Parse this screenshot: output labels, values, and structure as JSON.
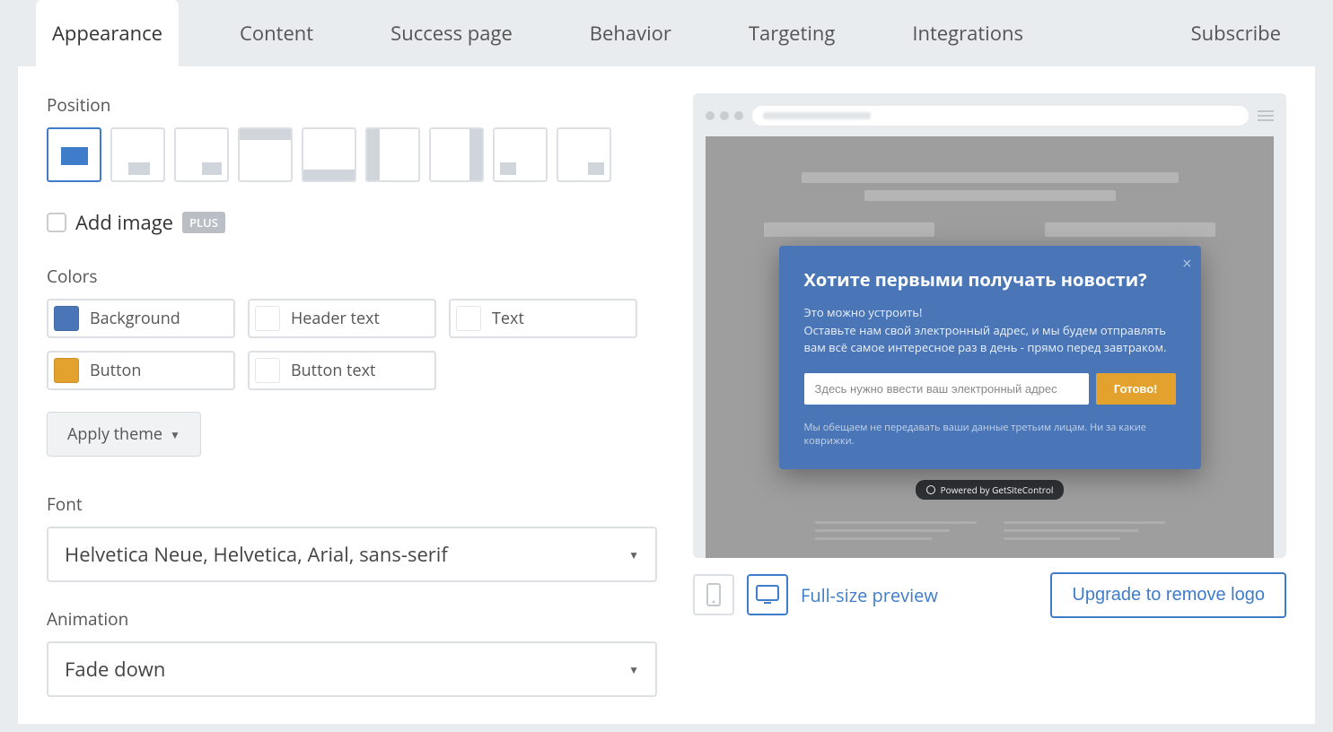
{
  "tabs": {
    "appearance": "Appearance",
    "content": "Content",
    "success": "Success page",
    "behavior": "Behavior",
    "targeting": "Targeting",
    "integrations": "Integrations",
    "subscribe": "Subscribe"
  },
  "labels": {
    "position": "Position",
    "add_image": "Add image",
    "plus_badge": "PLUS",
    "colors": "Colors",
    "font": "Font",
    "animation": "Animation",
    "apply_theme": "Apply theme",
    "full_size_preview": "Full-size preview",
    "upgrade": "Upgrade to remove logo"
  },
  "colors": {
    "background": {
      "label": "Background",
      "value": "#4a76b8"
    },
    "header_text": {
      "label": "Header text",
      "value": "#ffffff"
    },
    "text": {
      "label": "Text",
      "value": "#ffffff"
    },
    "button": {
      "label": "Button",
      "value": "#e2a22d"
    },
    "button_text": {
      "label": "Button text",
      "value": "#ffffff"
    }
  },
  "font": {
    "selected": "Helvetica Neue, Helvetica, Arial, sans-serif"
  },
  "animation": {
    "selected": "Fade down"
  },
  "preview": {
    "popup": {
      "title": "Хотите первыми получать новости?",
      "text_line1": "Это можно устроить!",
      "text_line2": "Оставьте нам свой электронный адрес, и мы будем отправлять вам всё самое интересное раз в день - прямо перед завтраком.",
      "email_placeholder": "Здесь нужно ввести ваш электронный адрес",
      "button_label": "Готово!",
      "footer_text": "Мы обещаем не передавать ваши данные третьим лицам. Ни за какие коврижки."
    },
    "powered_by": "Powered by GetSiteControl"
  }
}
